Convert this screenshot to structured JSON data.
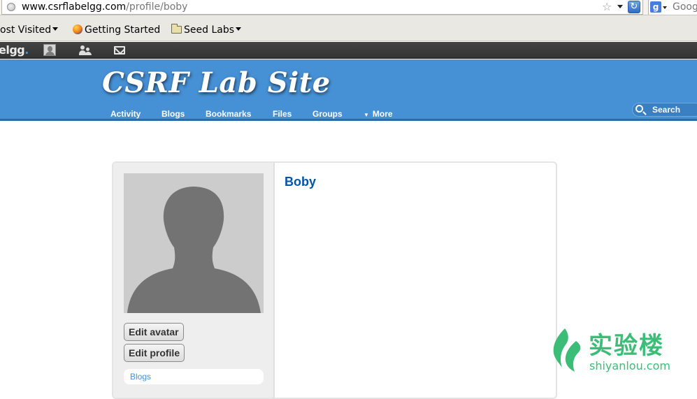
{
  "browser": {
    "url_host": "www.csrflabelgg.com",
    "url_path": "/profile/boby",
    "search_engine_text": "Goog",
    "search_engine_icon": "google-icon",
    "bookmarks": [
      {
        "label": "ost Visited",
        "icon": "none",
        "has_dropdown": true
      },
      {
        "label": "Getting Started",
        "icon": "firefox-icon",
        "has_dropdown": false
      },
      {
        "label": "Seed Labs",
        "icon": "folder-icon",
        "has_dropdown": true
      }
    ]
  },
  "topbar": {
    "logo_text": "elgg",
    "logo_suffix": ".",
    "icons": [
      "avatar-icon",
      "friends-icon",
      "messages-icon"
    ]
  },
  "header": {
    "site_name": "CSRF Lab Site",
    "nav": [
      "Activity",
      "Blogs",
      "Bookmarks",
      "Files",
      "Groups"
    ],
    "more_label": "More",
    "search_label": "Search"
  },
  "profile": {
    "name": "Boby",
    "buttons": {
      "edit_avatar": "Edit avatar",
      "edit_profile": "Edit profile"
    },
    "owner_menu": [
      "Blogs"
    ]
  },
  "watermark": {
    "cn": "实验楼",
    "en": "shiyanlou.com"
  },
  "colors": {
    "header_bg": "#4690d6",
    "topbar_bg": "#333333",
    "link": "#0054a7",
    "watermark": "#3bbd77"
  }
}
